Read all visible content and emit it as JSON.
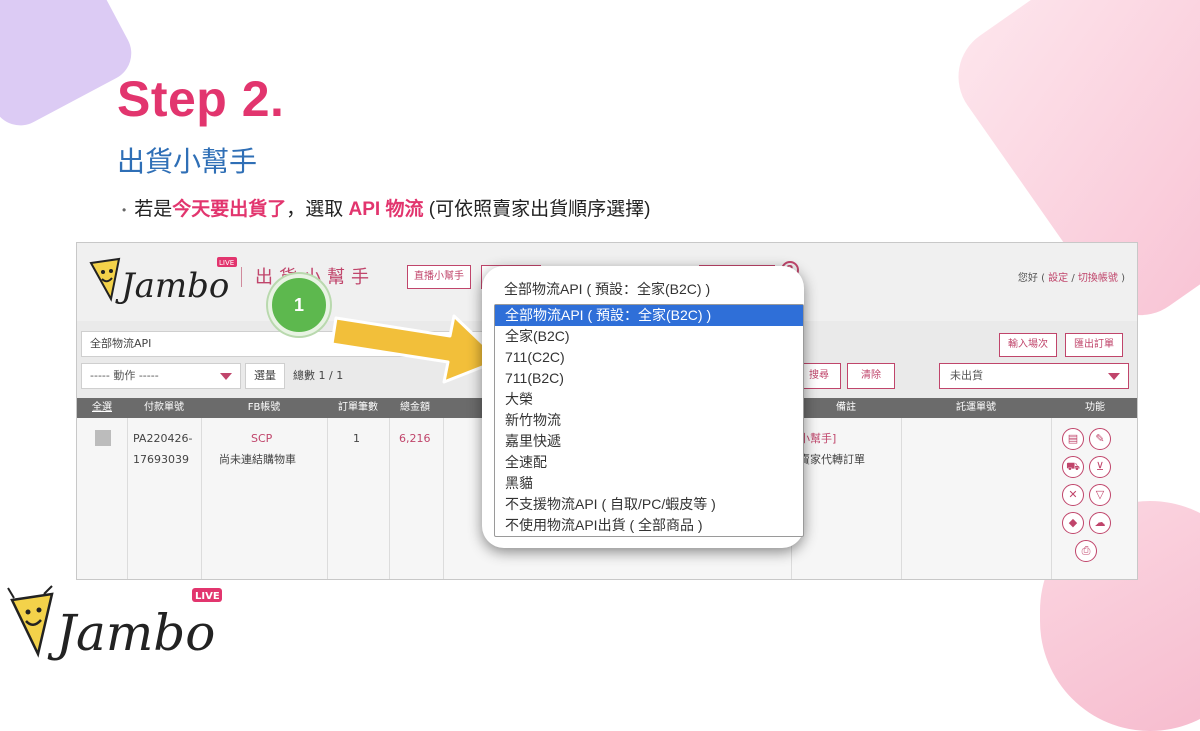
{
  "slide": {
    "title": "Step 2.",
    "subtitle": "出貨小幫手",
    "note_prefix": "若是",
    "note_highlight": "今天要出貨了",
    "note_mid": "，選取 ",
    "note_api": "API 物流",
    "note_suffix": " (可依照賣家出貨順序選擇)"
  },
  "app": {
    "logo_text": "Jambo",
    "logo_badge": "LIVE",
    "title": "出貨小幫手",
    "top_buttons": [
      "直播小幫手"
    ],
    "help": "?",
    "greeting": "您好 (",
    "settings": "設定",
    "switch_account": "切換帳號",
    "greeting_end": ")",
    "api_field_value": "全部物流API",
    "btn_import": "輸入場次",
    "btn_export": "匯出訂單",
    "action_select": "----- 動作 -----",
    "btn_select": "選量",
    "total": "總數 1 / 1",
    "btn_search": "搜尋",
    "btn_clear": "清除",
    "ship_status": "未出貨"
  },
  "table": {
    "headers": [
      "全選",
      "付款單號",
      "FB帳號",
      "訂單筆數",
      "總金額",
      "備註",
      "託運單號",
      "功能"
    ],
    "row": {
      "order_no_1": "PA220426-",
      "order_no_2": "17693039",
      "fb_account": "SCP",
      "fb_note": "尚未連結購物車",
      "count": "1",
      "amount": "6,216",
      "remark_1": "小幫手]",
      "remark_2": "賣家代轉訂單"
    }
  },
  "badge_number": "1",
  "dropdown": {
    "current": "全部物流API ( 預設：全家(B2C) )",
    "options": [
      "全部物流API ( 預設：全家(B2C) )",
      "全家(B2C)",
      "711(C2C)",
      "711(B2C)",
      "大榮",
      "新竹物流",
      "嘉里快遞",
      "全速配",
      "黑貓",
      "不支援物流API ( 自取/PC/蝦皮等 )",
      "不使用物流API出貨 ( 全部商品 )"
    ],
    "selected_index": 0
  },
  "colors": {
    "accent_pink": "#e2356e",
    "subtitle_blue": "#2f6fb6",
    "selection_blue": "#2f6fd8",
    "badge_green": "#5db84e",
    "arrow_yellow": "#f2bf3a"
  }
}
